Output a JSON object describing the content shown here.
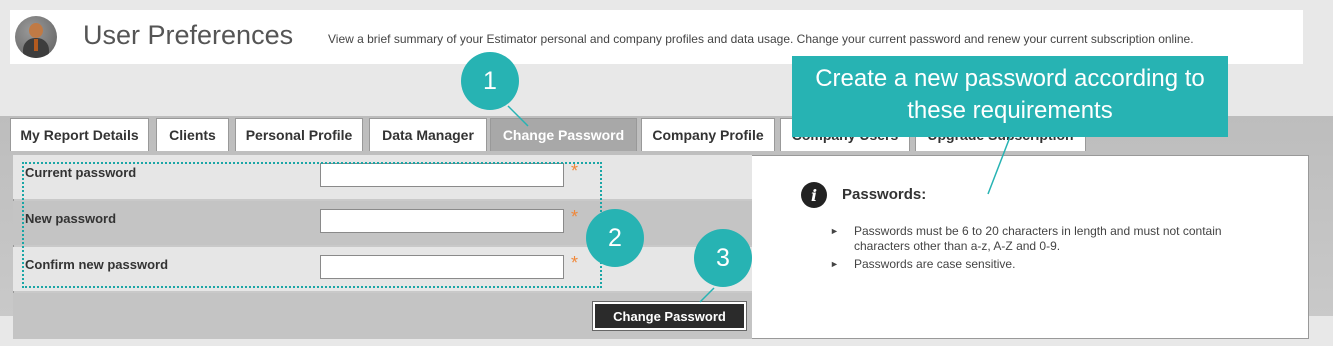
{
  "header": {
    "title": "User Preferences",
    "description": "View a brief summary of your Estimator personal and company profiles and data usage. Change your current password and renew your current subscription online.",
    "avatar_icon": "user-avatar-icon"
  },
  "tabs": [
    {
      "label": "My Report Details",
      "active": false
    },
    {
      "label": "Clients",
      "active": false
    },
    {
      "label": "Personal Profile",
      "active": false
    },
    {
      "label": "Data Manager",
      "active": false
    },
    {
      "label": "Change Password",
      "active": true
    },
    {
      "label": "Company Profile",
      "active": false
    },
    {
      "label": "Company Users",
      "active": false
    },
    {
      "label": "Upgrade Subscription",
      "active": false
    }
  ],
  "form": {
    "current_password": {
      "label": "Current password",
      "value": "",
      "required_mark": "*"
    },
    "new_password": {
      "label": "New password",
      "value": "",
      "required_mark": "*"
    },
    "confirm_password": {
      "label": "Confirm new password",
      "value": "",
      "required_mark": "*"
    },
    "submit_label": "Change Password"
  },
  "info": {
    "icon": "info-icon",
    "icon_glyph": "i",
    "title": "Passwords:",
    "bullets": [
      "Passwords must be 6 to 20 characters in length and must not contain characters other than a-z, A-Z and 0-9.",
      "Passwords are case sensitive."
    ]
  },
  "annotations": {
    "callout_1": "1",
    "callout_2": "2",
    "callout_3": "3",
    "banner": "Create a new password according to these requirements",
    "accent_color": "#27b3b3"
  }
}
